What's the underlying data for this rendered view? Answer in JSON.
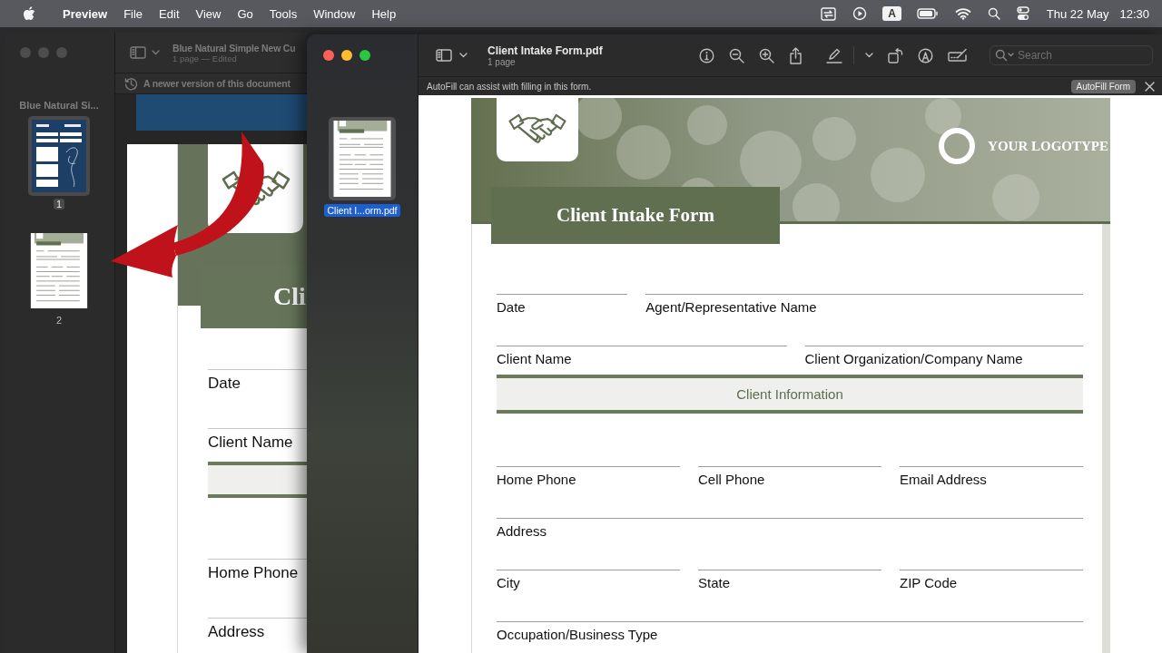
{
  "menu_bar": {
    "app": "Preview",
    "menus": [
      "File",
      "Edit",
      "View",
      "Go",
      "Tools",
      "Window",
      "Help"
    ],
    "input_source": "A",
    "date": "Thu 22 May",
    "time": "12:30"
  },
  "back_window": {
    "sidebar_title": "Blue Natural Si...",
    "pages": [
      {
        "label": "1",
        "kind": "blue",
        "selected": true
      },
      {
        "label": "2",
        "kind": "green",
        "selected": false
      }
    ],
    "title": "Blue Natural Simple New Cu",
    "subtitle": "1 page — Edited",
    "notice": "A newer version of this document",
    "document": {
      "title": "Cli",
      "items": [
        {
          "kind": "field",
          "label": "Date"
        },
        {
          "kind": "field",
          "label": "Client Name"
        },
        {
          "kind": "band"
        },
        {
          "kind": "field",
          "label": "Home Phone"
        },
        {
          "kind": "field",
          "label": "Address"
        }
      ]
    }
  },
  "front_window": {
    "thumbnails": [
      {
        "label": "Client I...orm.pdf",
        "kind": "green",
        "selected": true
      }
    ],
    "title": "Client Intake Form.pdf",
    "subtitle": "1 page",
    "search": {
      "placeholder": "Search"
    },
    "autofill": {
      "message": "AutoFill can assist with filling in this form.",
      "button": "AutoFill Form"
    },
    "document": {
      "logotype": "YOUR LOGOTYPE",
      "title": "Client Intake Form",
      "top_rows": [
        [
          "Date",
          "Agent/Representative Name"
        ],
        [
          "Client Name",
          "Client Organization/Company Name"
        ]
      ],
      "section": "Client Information",
      "rows": [
        [
          "Home Phone",
          "Cell Phone",
          "Email Address"
        ],
        [
          "Address"
        ],
        [
          "City",
          "State",
          "ZIP Code"
        ],
        [
          "Occupation/Business Type"
        ]
      ]
    }
  }
}
